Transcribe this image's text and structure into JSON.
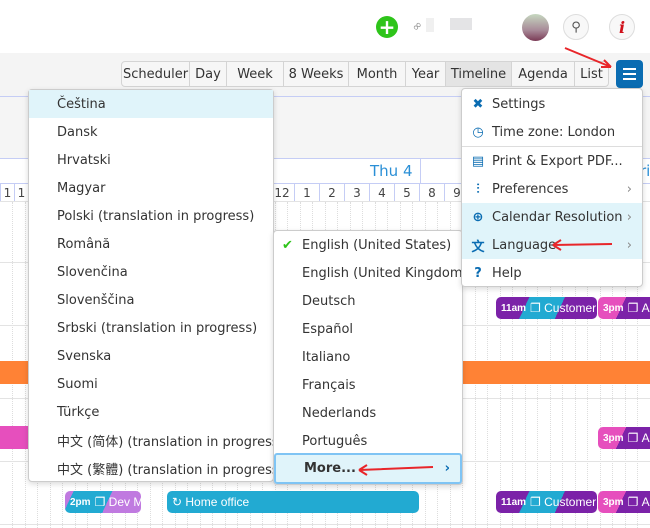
{
  "header": {
    "add_icon": "plus",
    "link_icon": "link",
    "search_icon": "magnifier",
    "info_icon": "i",
    "info_label": "i"
  },
  "toolbar": {
    "views": [
      "Scheduler",
      "Day",
      "Week",
      "8 Weeks",
      "Month",
      "Year",
      "Timeline",
      "Agenda",
      "List"
    ],
    "active_view": "Timeline",
    "menu_icon": "hamburger"
  },
  "calendar": {
    "day_header": "Thu 4",
    "next_day_partial": "ri",
    "hours_left": [
      "1",
      "1"
    ],
    "hours": [
      "12",
      "1",
      "2",
      "3",
      "4",
      "5",
      "8",
      "9"
    ],
    "events": {
      "customer": "Customer",
      "customer_time": "11am",
      "a_time": "3pm",
      "a_label": "A",
      "dev_time": "2pm",
      "dev_label": "Dev M",
      "home_office": "Home office"
    }
  },
  "main_menu": {
    "items": [
      {
        "label": "Settings",
        "icon": "tools"
      },
      {
        "label": "Time zone: London",
        "icon": "clock"
      },
      {
        "label": "Print & Export PDF...",
        "icon": "printer"
      },
      {
        "label": "Preferences",
        "icon": "sliders"
      },
      {
        "label": "Calendar Resolution",
        "icon": "zoom-in"
      },
      {
        "label": "Language",
        "icon": "translate"
      },
      {
        "label": "Help",
        "icon": "question"
      }
    ]
  },
  "language_menu": {
    "items": [
      "English (United States)",
      "English (United Kingdom)",
      "Deutsch",
      "Español",
      "Italiano",
      "Français",
      "Nederlands",
      "Português"
    ],
    "selected": "English (United States)",
    "more": "More..."
  },
  "more_languages": {
    "items": [
      "Čeština",
      "Dansk",
      "Hrvatski",
      "Magyar",
      "Polski (translation in progress)",
      "Română",
      "Slovenčina",
      "Slovenščina",
      "Srbski (translation in progress)",
      "Svenska",
      "Suomi",
      "Türkçe",
      "中文 (简体) (translation in progress)",
      "中文 (繁體) (translation in progress)"
    ]
  },
  "colors": {
    "accent": "#0a6cb2",
    "add": "#2ec41a",
    "orange": "#ff8235",
    "cyan": "#22aad2",
    "purple": "#7b22a8",
    "pink": "#e64fbd",
    "lavender": "#c07ae0",
    "highlight": "#e0f4fa"
  }
}
